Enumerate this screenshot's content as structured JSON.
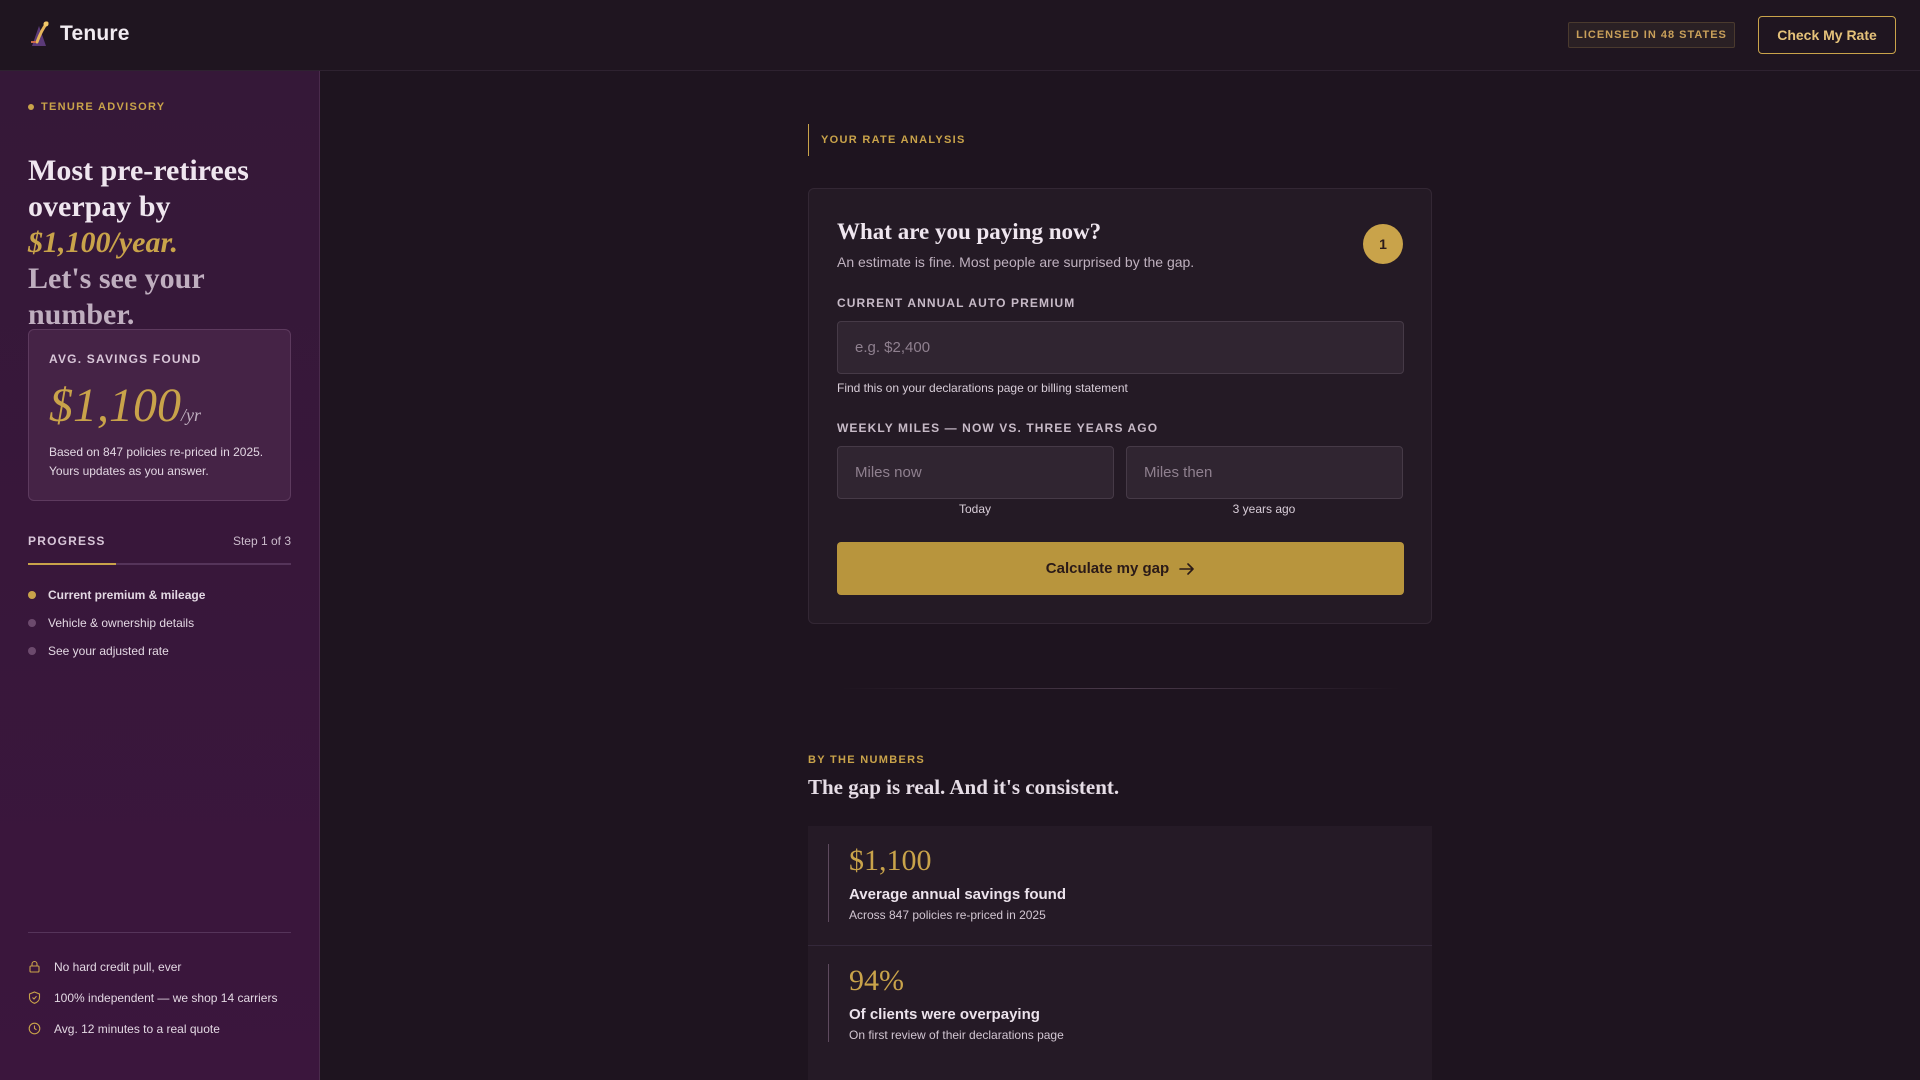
{
  "header": {
    "brand": "Tenure",
    "licensed_badge": "LICENSED IN 48 STATES",
    "cta": "Check My Rate"
  },
  "sidebar": {
    "eyebrow": "TENURE ADVISORY",
    "hero_line1": "Most pre-retirees overpay by",
    "hero_amount": "$1,100/year.",
    "hero_line3": "Let's see your number.",
    "savings": {
      "label": "AVG. SAVINGS FOUND",
      "amount": "$1,100",
      "per": "/yr",
      "note": "Based on 847 policies re-priced in 2025. Yours updates as you answer."
    },
    "progress": {
      "title": "PROGRESS",
      "step_text": "Step 1 of 3",
      "value": 0.333,
      "steps": [
        {
          "label": "Current premium & mileage",
          "active": true
        },
        {
          "label": "Vehicle & ownership details",
          "active": false
        },
        {
          "label": "See your adjusted rate",
          "active": false
        }
      ]
    },
    "trust": [
      {
        "icon": "lock-icon",
        "label": "No hard credit pull, ever"
      },
      {
        "icon": "shield-icon",
        "label": "100% independent — we shop 14 carriers"
      },
      {
        "icon": "clock-icon",
        "label": "Avg. 12 minutes to a real quote"
      }
    ]
  },
  "main": {
    "analysis_label": "YOUR RATE ANALYSIS",
    "form": {
      "title": "What are you paying now?",
      "subtitle": "An estimate is fine. Most people are surprised by the gap.",
      "step_badge": "1",
      "premium_label": "CURRENT ANNUAL AUTO PREMIUM",
      "premium_value": "",
      "premium_placeholder": "e.g. $2,400",
      "premium_hint": "Find this on your declarations page or billing statement",
      "miles_label": "WEEKLY MILES — NOW VS. THREE YEARS AGO",
      "miles_now_value": "",
      "miles_now_placeholder": "Miles now",
      "miles_now_caption": "Today",
      "miles_then_value": "",
      "miles_then_placeholder": "Miles then",
      "miles_then_caption": "3 years ago",
      "submit": "Calculate my gap"
    },
    "numbers": {
      "eyebrow": "BY THE NUMBERS",
      "title": "The gap is real. And it's consistent.",
      "stats": [
        {
          "value": "$1,100",
          "title": "Average annual savings found",
          "desc": "Across 847 policies re-priced in 2025"
        },
        {
          "value": "94%",
          "title": "Of clients were overpaying",
          "desc": "On first review of their declarations page"
        }
      ]
    }
  },
  "colors": {
    "accent_gold": "#c9a34a",
    "sidebar_purple": "#3b163d",
    "background": "#1e141f"
  }
}
